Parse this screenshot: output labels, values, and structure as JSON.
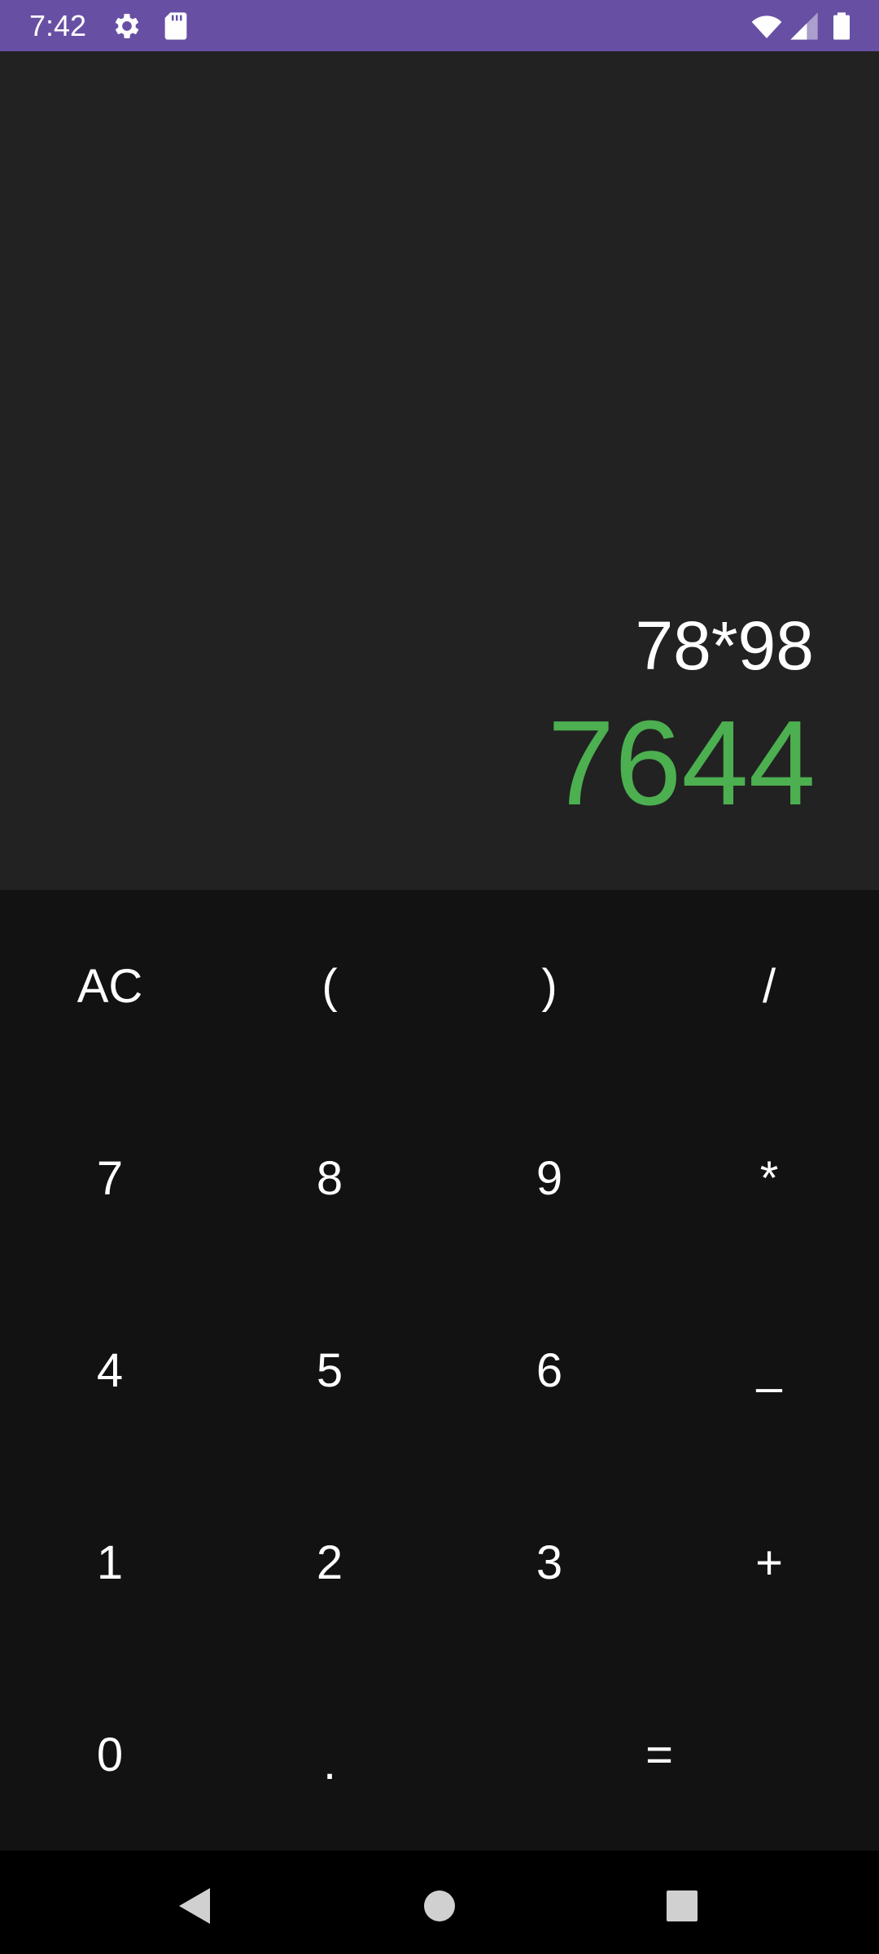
{
  "status_bar": {
    "time": "7:42",
    "background_color": "#6750a4",
    "icons": [
      "gear-icon",
      "sd-card-icon",
      "wifi-icon",
      "signal-icon",
      "battery-icon"
    ]
  },
  "display": {
    "expression": "78*98",
    "result": "7644",
    "result_color": "#4caf50"
  },
  "keypad": {
    "row1": [
      "AC",
      "(",
      ")",
      "/"
    ],
    "row2": [
      "7",
      "8",
      "9",
      "*"
    ],
    "row3": [
      "4",
      "5",
      "6",
      "–"
    ],
    "row4": [
      "1",
      "2",
      "3",
      "+"
    ],
    "row5": [
      "0",
      ".",
      "="
    ]
  },
  "nav_bar": {
    "buttons": [
      "back-icon",
      "home-icon",
      "recents-icon"
    ]
  }
}
